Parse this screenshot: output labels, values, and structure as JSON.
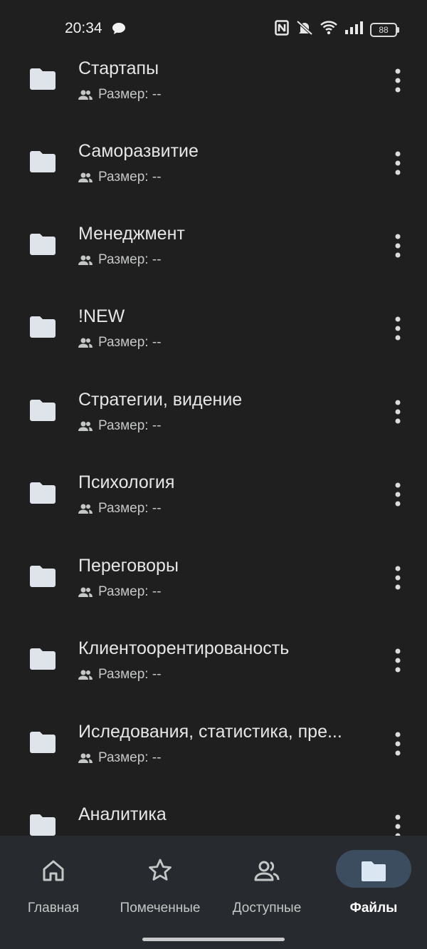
{
  "status_bar": {
    "time": "20:34",
    "battery": "88"
  },
  "files": [
    {
      "name": "Стартапы",
      "meta": "Размер: --"
    },
    {
      "name": "Саморазвитие",
      "meta": "Размер: --"
    },
    {
      "name": "Менеджмент",
      "meta": "Размер: --"
    },
    {
      "name": "!NEW",
      "meta": "Размер: --"
    },
    {
      "name": "Стратегии, видение",
      "meta": "Размер: --"
    },
    {
      "name": "Психология",
      "meta": "Размер: --"
    },
    {
      "name": "Переговоры",
      "meta": "Размер: --"
    },
    {
      "name": "Клиентоорентированость",
      "meta": "Размер: --"
    },
    {
      "name": "Иследования, статистика, пре...",
      "meta": "Размер: --"
    },
    {
      "name": "Аналитика",
      "meta": ""
    }
  ],
  "bottom_nav": {
    "home": "Главная",
    "starred": "Помеченные",
    "shared": "Доступные",
    "files": "Файлы",
    "active": "files"
  },
  "colors": {
    "background": "#1f1f1f",
    "nav_background": "#272a2e",
    "active_pill": "#3b4d5e",
    "folder_icon": "#dfe3ea"
  }
}
